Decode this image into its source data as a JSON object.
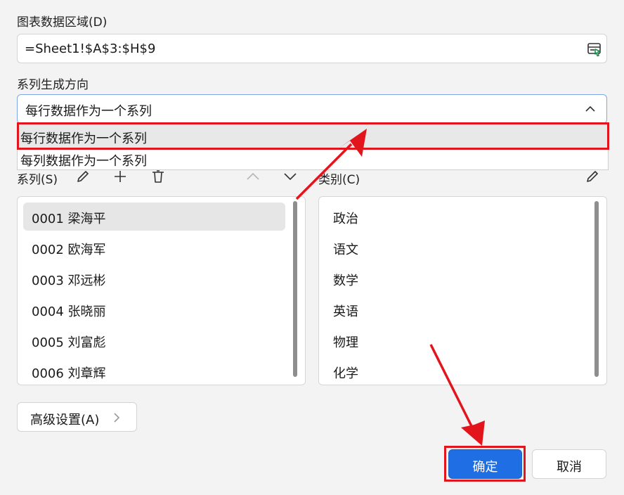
{
  "data_range": {
    "label": "图表数据区域(D)",
    "value": "=Sheet1!$A$3:$H$9",
    "picker_icon": "range-select-icon"
  },
  "series_direction": {
    "label": "系列生成方向",
    "selected": "每行数据作为一个系列",
    "options": [
      "每行数据作为一个系列",
      "每列数据作为一个系列"
    ]
  },
  "series_panel": {
    "label": "系列(S)",
    "items": [
      "0001 梁海平",
      "0002 欧海军",
      "0003 邓远彬",
      "0004 张晓丽",
      "0005 刘富彪",
      "0006 刘章辉"
    ]
  },
  "category_panel": {
    "label": "类别(C)",
    "items": [
      "政治",
      "语文",
      "数学",
      "英语",
      "物理",
      "化学"
    ]
  },
  "advanced_button": {
    "label": "高级设置(A)"
  },
  "footer": {
    "ok_label": "确定",
    "cancel_label": "取消"
  },
  "colors": {
    "accent": "#1f6ee3",
    "annotation": "#e2141c",
    "background": "#f3f3f3"
  }
}
